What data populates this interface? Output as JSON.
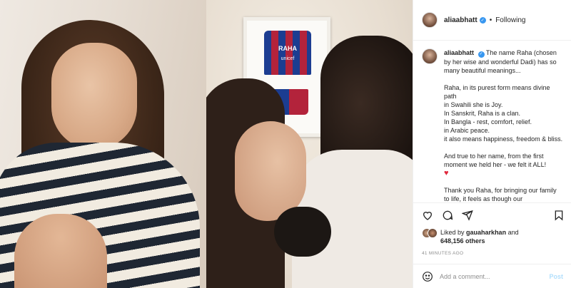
{
  "header": {
    "username": "aliaabhatt",
    "dot": "•",
    "following": "Following"
  },
  "caption": {
    "username": "aliaabhatt",
    "lines": [
      "The name Raha (chosen by her wise and wonderful Dadi) has so many beautiful meanings...",
      "",
      "Raha, in its purest form means divine path",
      "in Swahili she is Joy.",
      "In Sanskrit, Raha is a clan.",
      "In Bangla - rest, comfort, relief.",
      "in Arabic peace.",
      "it also means happiness, freedom & bliss.",
      "",
      "And true to her name, from the first moment we held her - we felt it ALL!",
      "",
      "",
      "Thank you Raha, for bringing our family to life, it feels as though our"
    ],
    "heart": "♥"
  },
  "jersey": {
    "name": "RAHA",
    "sponsor": "unicef"
  },
  "likes": {
    "prefix": "Liked by",
    "user": "gauaharkhan",
    "and": "and",
    "count": "648,156 others"
  },
  "timestamp": "41 MINUTES AGO",
  "comment": {
    "placeholder": "Add a comment...",
    "post_label": "Post"
  },
  "colors": {
    "verified": "#3897f0",
    "post_disabled": "#b2dffc",
    "heart": "#e0283c"
  },
  "icons": [
    "heart-icon",
    "comment-icon",
    "share-icon",
    "save-icon",
    "emoji-icon",
    "verified-icon"
  ]
}
